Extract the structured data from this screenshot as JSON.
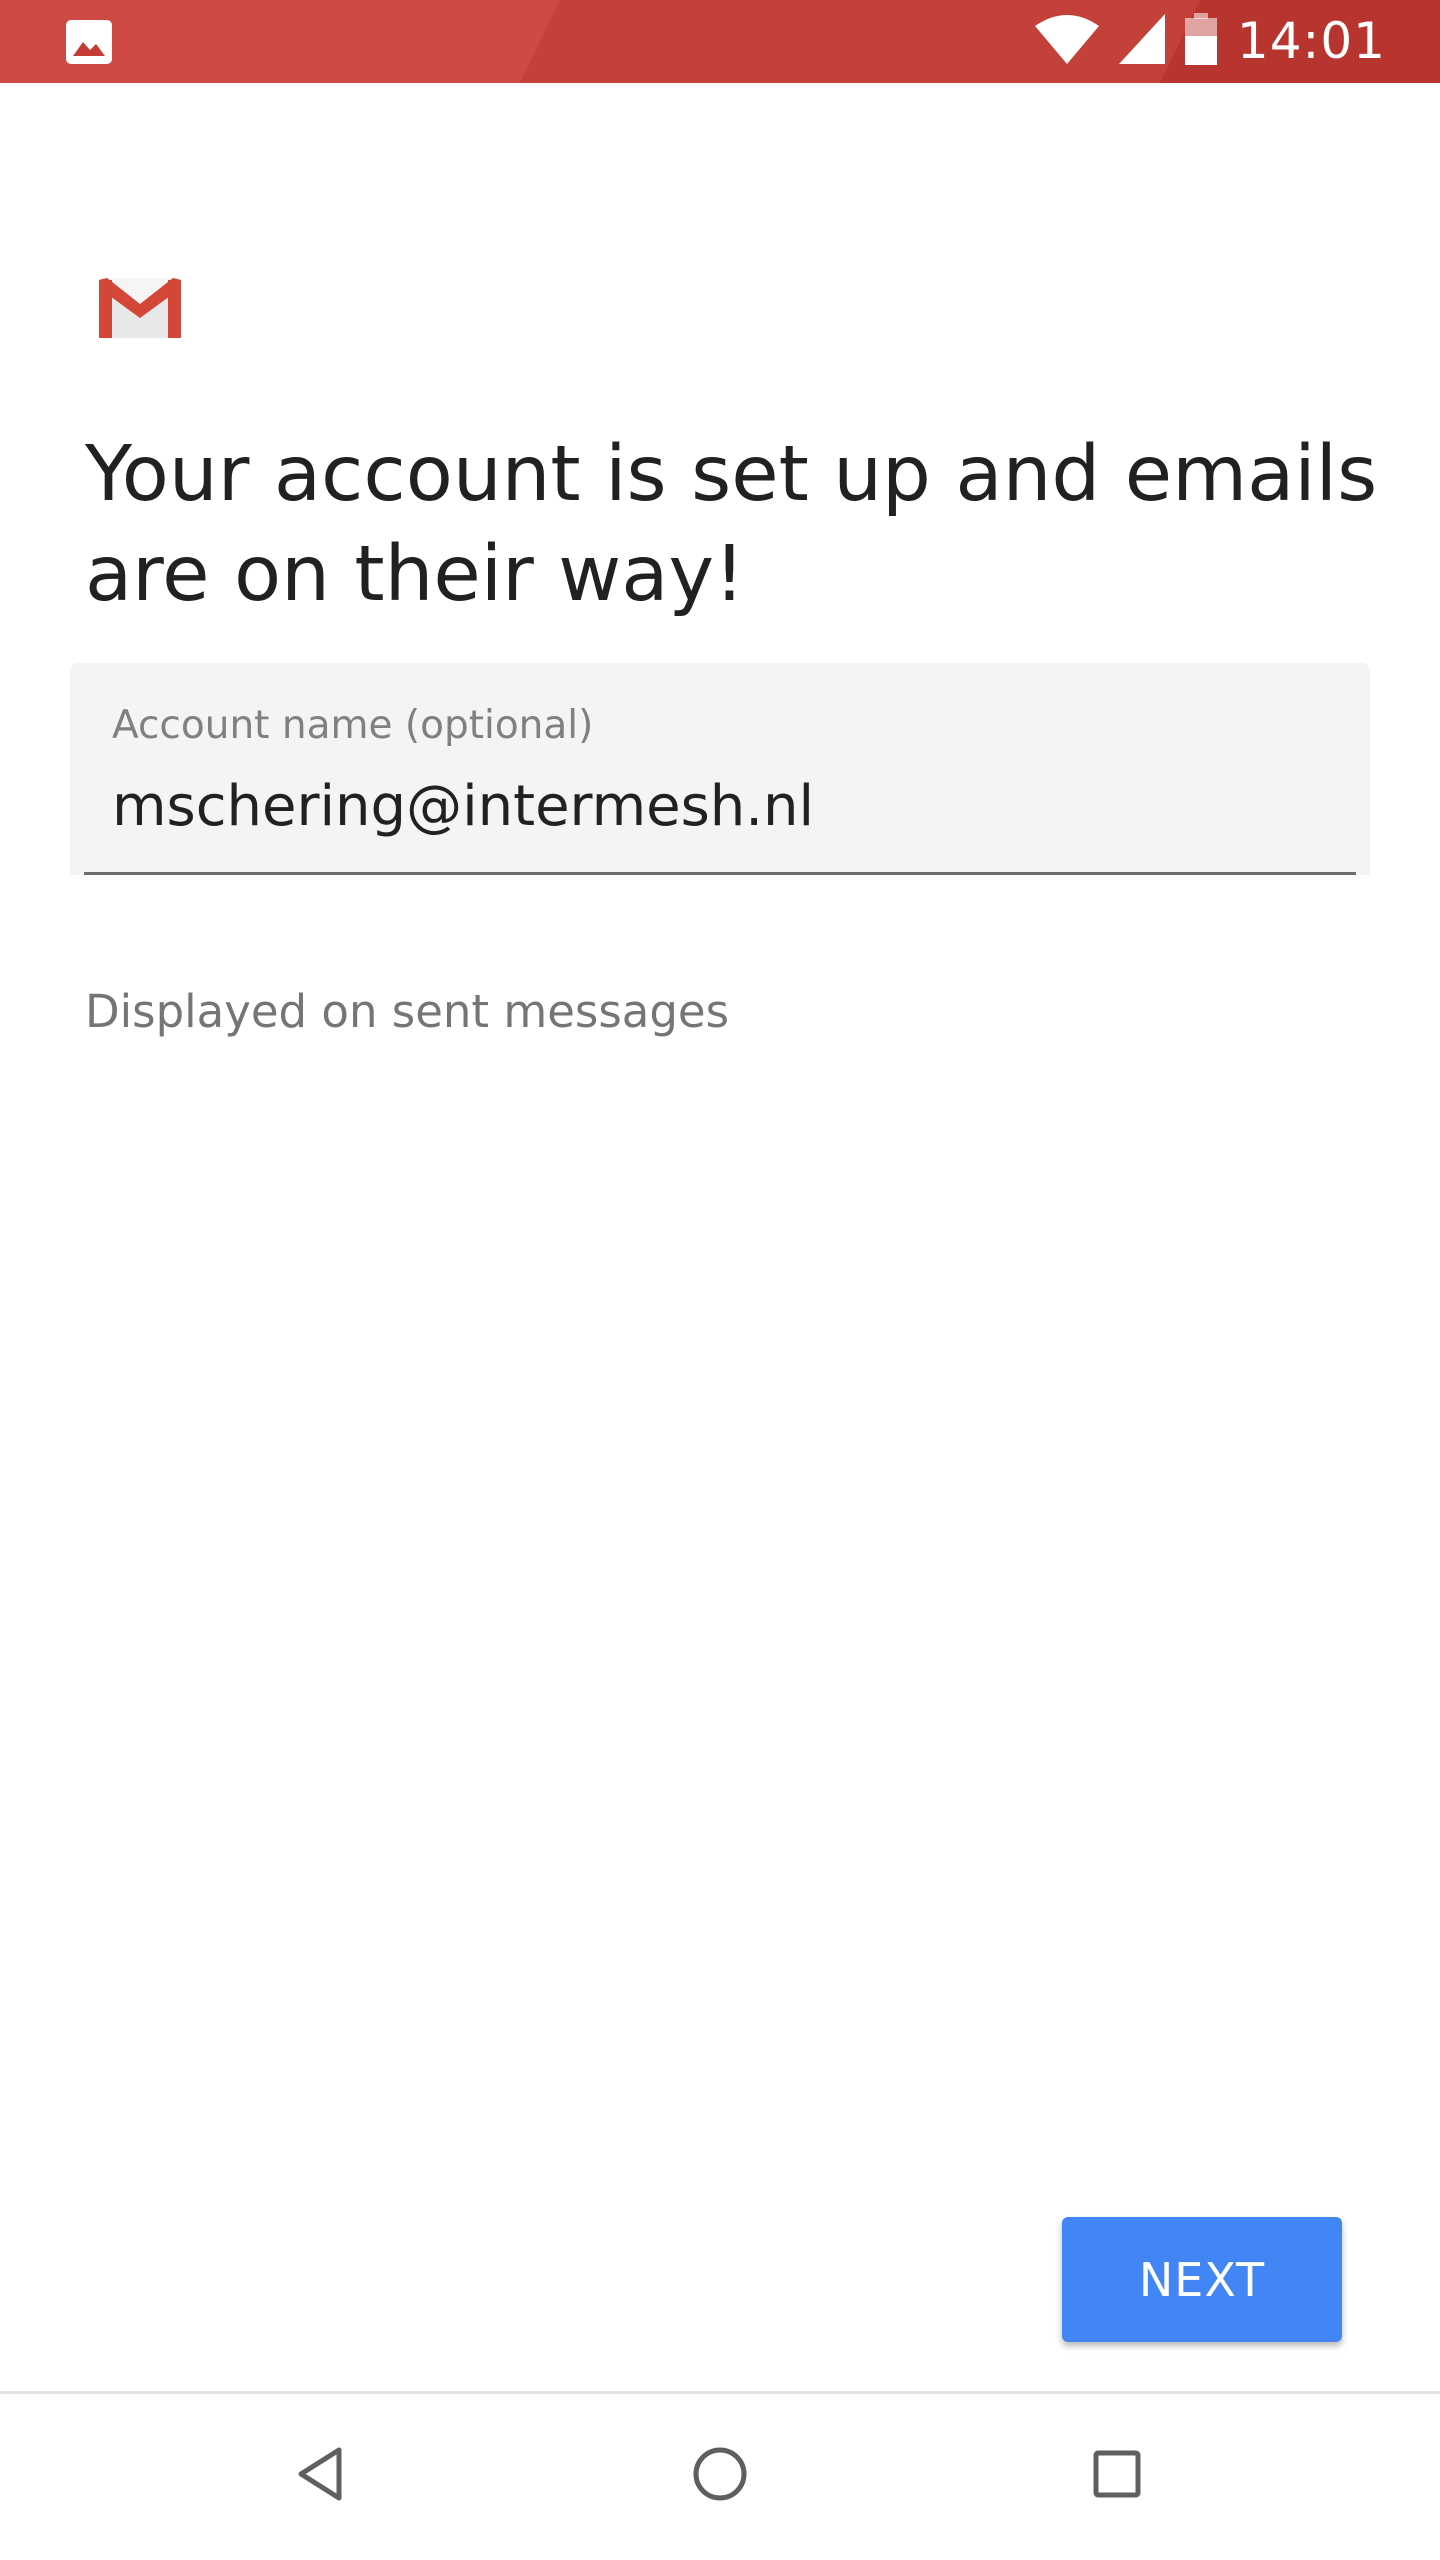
{
  "status_bar": {
    "time": "14:01",
    "left_icon": "image-icon",
    "icons": [
      "wifi-icon",
      "cell-signal-icon",
      "battery-icon"
    ],
    "background_color": "#c43c36"
  },
  "logo": {
    "icon": "gmail-icon"
  },
  "main": {
    "title": "Your account is set up and emails are on their way!",
    "account_field": {
      "label": "Account name (optional)",
      "value": "mschering@intermesh.nl"
    },
    "helper_text": "Displayed on sent messages"
  },
  "footer": {
    "next_label": "NEXT",
    "accent_color": "#4285f4"
  },
  "nav_bar": {
    "icons": [
      "back-icon",
      "home-icon",
      "recents-icon"
    ]
  }
}
